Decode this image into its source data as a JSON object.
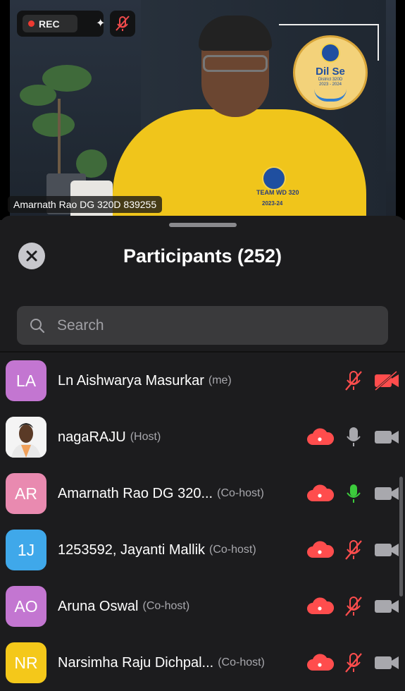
{
  "video": {
    "rec_label": "REC",
    "speaker_name_tag": "Amarnath Rao DG 320D 839255",
    "logo": {
      "title": "Dil Se",
      "sub1": "District 320D",
      "sub2": "2023 - 2024"
    },
    "shirt_text": {
      "line1": "TEAM WD 320",
      "line2": "2023-24"
    }
  },
  "sheet": {
    "title": "Participants (252)",
    "search_placeholder": "Search"
  },
  "participants": [
    {
      "initials": "LA",
      "avatar_color": "#c376d1",
      "name": "Ln Aishwarya Masurkar",
      "role": "(me)",
      "cloud": false,
      "mic": "muted-red",
      "cam": "off-red"
    },
    {
      "initials": "",
      "avatar_color": "#f2f2f2",
      "avatar_photo": true,
      "name": "nagaRAJU",
      "role": "(Host)",
      "cloud": true,
      "mic": "on-grey",
      "cam": "on-grey"
    },
    {
      "initials": "AR",
      "avatar_color": "#e98ab0",
      "name": "Amarnath Rao DG 320...",
      "role": "(Co-host)",
      "cloud": true,
      "mic": "active-green",
      "cam": "on-grey"
    },
    {
      "initials": "1J",
      "avatar_color": "#3fa8ea",
      "name": "1253592, Jayanti Mallik",
      "role": "(Co-host)",
      "cloud": true,
      "mic": "muted-red",
      "cam": "on-grey"
    },
    {
      "initials": "AO",
      "avatar_color": "#c376d1",
      "name": "Aruna Oswal",
      "role": "(Co-host)",
      "cloud": true,
      "mic": "muted-red",
      "cam": "on-grey"
    },
    {
      "initials": "NR",
      "avatar_color": "#f4c81a",
      "name": "Narsimha Raju Dichpal...",
      "role": "(Co-host)",
      "cloud": true,
      "mic": "muted-red",
      "cam": "on-grey"
    }
  ],
  "colors": {
    "red": "#ff4d4d",
    "green": "#3ccb3c",
    "grey": "#a8a8ad"
  }
}
